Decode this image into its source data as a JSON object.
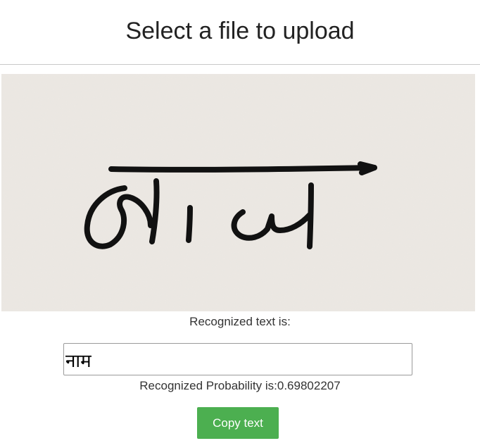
{
  "header": {
    "title": "Select a file to upload"
  },
  "image": {
    "alt": "handwritten word image"
  },
  "result": {
    "label": "Recognized text is:",
    "text_value": "नाम",
    "probability_text": "Recognized Probability is:0.69802207"
  },
  "actions": {
    "copy_label": "Copy text",
    "copy_color": "#4caf50"
  }
}
